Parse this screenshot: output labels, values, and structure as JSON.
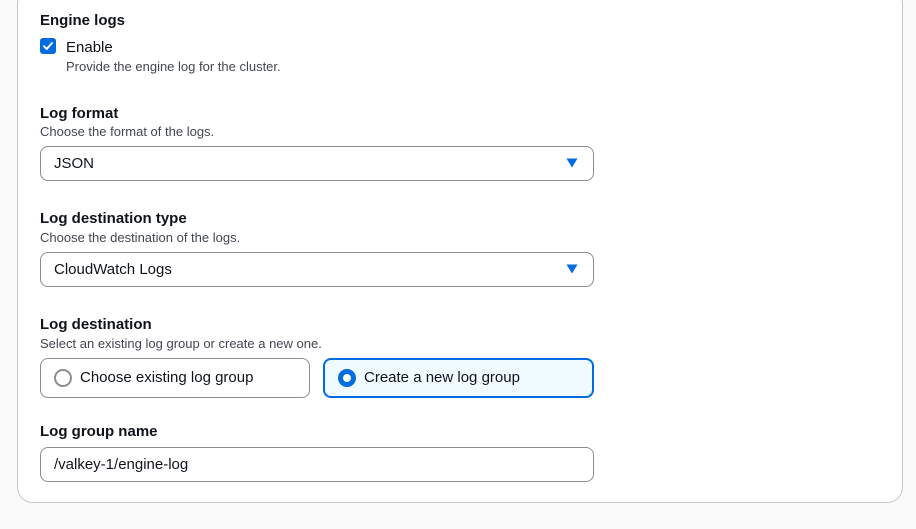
{
  "engine_logs": {
    "label": "Engine logs",
    "checkbox_label": "Enable",
    "checkbox_checked": true,
    "description": "Provide the engine log for the cluster."
  },
  "log_format": {
    "label": "Log format",
    "description": "Choose the format of the logs.",
    "selected": "JSON"
  },
  "log_destination_type": {
    "label": "Log destination type",
    "description": "Choose the destination of the logs.",
    "selected": "CloudWatch Logs"
  },
  "log_destination": {
    "label": "Log destination",
    "description": "Select an existing log group or create a new one.",
    "options": [
      {
        "label": "Choose existing log group",
        "selected": false
      },
      {
        "label": "Create a new log group",
        "selected": true
      }
    ]
  },
  "log_group_name": {
    "label": "Log group name",
    "value": "/valkey-1/engine-log"
  },
  "colors": {
    "accent": "#006ce0",
    "selected_tile_bg": "#f0fbff",
    "border": "#8c8c94"
  },
  "icons": {
    "checkbox": "check-icon",
    "dropdown": "caret-down-icon"
  }
}
